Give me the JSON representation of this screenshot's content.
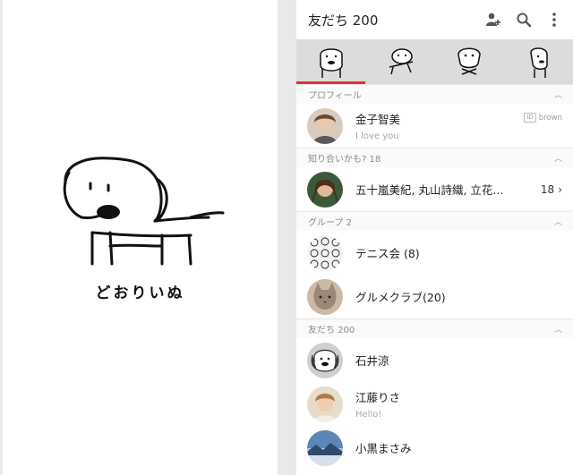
{
  "splash": {
    "brand_text": "どおりいぬ",
    "illustration": "dog-line-drawing"
  },
  "header": {
    "title": "友だち 200",
    "icons": [
      "add-friend-icon",
      "search-icon",
      "more-vert-icon"
    ]
  },
  "sticker_tabs": [
    "dog-pout-sticker",
    "dog-run-sticker",
    "dog-crossed-arms-sticker",
    "dog-side-sticker"
  ],
  "sections": {
    "profile": {
      "header": "プロフィール",
      "name": "金子智美",
      "status": "I love you",
      "id_badge": "ID",
      "id_value": "brown"
    },
    "suggest": {
      "header": "知り合いかも? 18",
      "names": "五十嵐美紀, 丸山詩織, 立花...",
      "count": "18"
    },
    "groups": {
      "header": "グループ 2",
      "items": [
        {
          "name": "テニス会 (8)"
        },
        {
          "name": "グルメクラブ(20)"
        }
      ]
    },
    "friends": {
      "header": "友だち 200",
      "items": [
        {
          "name": "石井涼",
          "status": ""
        },
        {
          "name": "江藤りさ",
          "status": "Hello!"
        },
        {
          "name": "小黒まさみ",
          "status": ""
        }
      ]
    }
  },
  "colors": {
    "accent": "#e5322d",
    "sticker_bar": "#dcdcdc",
    "divider": "#e6e6e6"
  }
}
